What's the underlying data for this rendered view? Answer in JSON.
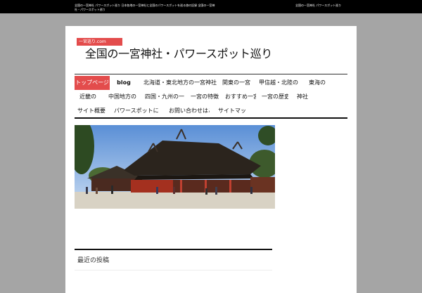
{
  "topbar": {
    "left_text": "全国の一宮神社 パワースポット巡り 日本各地の一宮神社と全国のパワースポットを巡る旅の記録 全国の一宮神社・パワースポット巡り",
    "right_text": "全国の一宮神社 パワースポット巡り"
  },
  "header": {
    "logo_text": "一宮巡り.com",
    "site_title": "全国の一宮神社・パワースポット巡り"
  },
  "nav": {
    "items": [
      {
        "label": "トップページ"
      },
      {
        "label": "blog"
      },
      {
        "label": "北海道・東北地方の一宮神社・パワースポット"
      },
      {
        "label": "関東の一宮"
      },
      {
        "label": "甲信越・北陸の一宮"
      },
      {
        "label": "東海の"
      },
      {
        "label": "近畿の"
      },
      {
        "label": "中国地方の"
      },
      {
        "label": "四国・九州の一宮"
      },
      {
        "label": "一宮の特徴"
      },
      {
        "label": "おすすめ一宮"
      },
      {
        "label": "一宮の歴史"
      },
      {
        "label": "神社"
      },
      {
        "label": "サイト概要"
      },
      {
        "label": "パワースポットに行こう♪"
      },
      {
        "label": "お問い合わせはこちら"
      },
      {
        "label": "サイトマップ"
      }
    ]
  },
  "main": {
    "hero_alt": "住吉大社",
    "section_title": "最近の投稿"
  },
  "colors": {
    "accent": "#e34c4c",
    "topbar": "#000000",
    "background": "#a5a5a5"
  }
}
